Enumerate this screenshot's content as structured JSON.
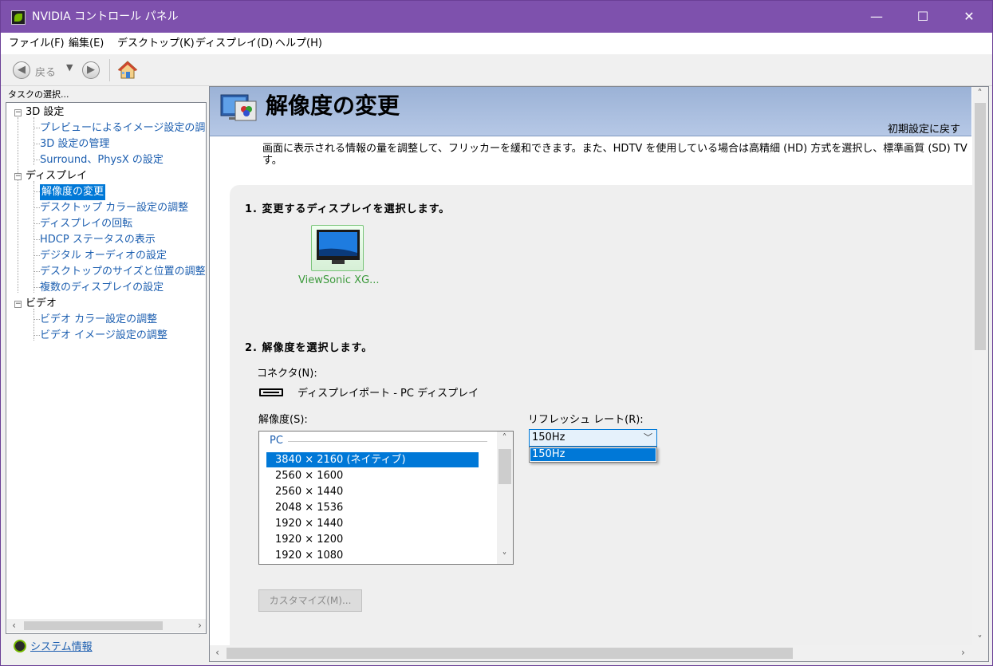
{
  "window": {
    "title": "NVIDIA コントロール パネル",
    "controls": {
      "minimize": "—",
      "maximize": "☐",
      "close": "✕"
    }
  },
  "menu": [
    "ファイル(F)",
    "編集(E)",
    "デスクトップ(K)",
    "ディスプレイ(D)",
    "ヘルプ(H)"
  ],
  "toolbar": {
    "back_label": "戻る"
  },
  "sidebar": {
    "task_label": "タスクの選択...",
    "groups": [
      {
        "label": "3D 設定",
        "items": [
          "プレビューによるイメージ設定の調整",
          "3D 設定の管理",
          "Surround、PhysX の設定"
        ]
      },
      {
        "label": "ディスプレイ",
        "items": [
          "解像度の変更",
          "デスクトップ カラー設定の調整",
          "ディスプレイの回転",
          "HDCP ステータスの表示",
          "デジタル オーディオの設定",
          "デスクトップのサイズと位置の調整",
          "複数のディスプレイの設定"
        ]
      },
      {
        "label": "ビデオ",
        "items": [
          "ビデオ カラー設定の調整",
          "ビデオ イメージ設定の調整"
        ]
      }
    ],
    "selected_item": "解像度の変更",
    "system_info": "システム情報"
  },
  "main": {
    "title": "解像度の変更",
    "restore_defaults": "初期設定に戻す",
    "description": "画面に表示される情報の量を調整して、フリッカーを緩和できます。また、HDTV を使用している場合は高精細 (HD) 方式を選択し、標準画質 (SD) TV す。",
    "step1": "1. 変更するディスプレイを選択します。",
    "display_name": "ViewSonic XG...",
    "step2": "2. 解像度を選択します。",
    "connector_label": "コネクタ(N):",
    "connector_value": "ディスプレイポート - PC ディスプレイ",
    "resolution_label": "解像度(S):",
    "resolution_group": "PC",
    "resolutions": [
      "3840 × 2160 (ネイティブ)",
      "2560 × 1600",
      "2560 × 1440",
      "2048 × 1536",
      "1920 × 1440",
      "1920 × 1200",
      "1920 × 1080"
    ],
    "selected_resolution": "3840 × 2160 (ネイティブ)",
    "refresh_label": "リフレッシュ レート(R):",
    "refresh_value": "150Hz",
    "refresh_options": [
      "150Hz"
    ],
    "customize_button": "カスタマイズ(M)..."
  },
  "colors": {
    "titlebar": "#7e51ad",
    "selection": "#0078d7",
    "link": "#1d5fb0",
    "header": "#9bb2d6"
  }
}
